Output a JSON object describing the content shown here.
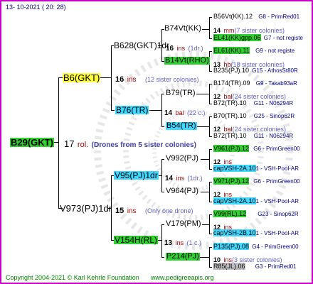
{
  "header": {
    "date": "13- 10-2021 ( 20: 28)"
  },
  "footer": {
    "copyright": "Copyright 2004-2021 © Karl Kehrle Foundation",
    "site": "www.pedigreeapis.org"
  },
  "root": {
    "id": "B29(GKT)",
    "count": "17",
    "ins": "rol.",
    "note": "(Drones from 5 sister colonies)"
  },
  "g1": {
    "mother": {
      "id": "B6(GKT)",
      "count": "16",
      "ins": "ins",
      "note": "(12 sister colonies)"
    },
    "father": {
      "id": "V973(PJ)1dr",
      "count": "15",
      "ins": "ins",
      "note": "(Only one drone)"
    }
  },
  "g2": {
    "b628": {
      "id": "B628(GKT)1dr",
      "count": "16",
      "ins": "ins",
      "note": "(1dr.)"
    },
    "b76": {
      "id": "B76(TR)",
      "count": "14",
      "ins": "bal",
      "note": "(22 c.)"
    },
    "v95": {
      "id": "V95(PJ)1dr",
      "count": "14",
      "ins": "ins",
      "note": "(1dr.)"
    },
    "v154": {
      "id": "V154H(RL)",
      "count": "13",
      "ins": "ins",
      "note": "(1 c.)"
    }
  },
  "g3": {
    "b74vt": {
      "id": "B74Vt(KK)"
    },
    "b14vt": {
      "id": "B14Vt(RHO)"
    },
    "b79": {
      "id": "B79(TR)"
    },
    "b54": {
      "id": "B54(TR)"
    },
    "v992": {
      "id": "V992(PJ)"
    },
    "v964": {
      "id": "V964(PJ)"
    },
    "v179": {
      "id": "V179(PM)"
    },
    "p214": {
      "id": "P214(PJ)"
    }
  },
  "g4": [
    {
      "id": "B56Vt(KK).12",
      "lin": "G8 - PrimRed01"
    },
    {
      "count": "14",
      "ins": "mm",
      "note": "(7 sister colonies)"
    },
    {
      "id": "EL41(KK)gpp.06",
      "lin": "G7 - not registe"
    },
    {
      "id": "EL61(KK).11",
      "lin": "G9 - not registe"
    },
    {
      "count": "13",
      "ins": "hb",
      "note": "(18 sister colonies)"
    },
    {
      "id": "B235(PJ).10",
      "lin": "G15 - AthosSt80R"
    },
    {
      "id": "B174(TR).09",
      "lin": "G9 - Takab93aR"
    },
    {
      "count": "12",
      "ins": "bal",
      "note": "(24 sister colonies)"
    },
    {
      "id": "B72(TR).10",
      "lin": "G11 - N06294R"
    },
    {
      "id": "B70(TR).10",
      "lin": "G25 - Sinop62R"
    },
    {
      "count": "12",
      "ins": "bal",
      "note": "(24 sister colonies)"
    },
    {
      "id": "B72(TR).10",
      "lin": "G11 - N06294R"
    },
    {
      "id": "V961(PJ).12",
      "lin": "G6 - PrimGreen00"
    },
    {
      "count": "12",
      "ins": "ins",
      "note": ""
    },
    {
      "id": "capVSH-2A.10",
      "lin": "1 - VSH-Pool-AR"
    },
    {
      "id": "V971(PJ).12",
      "lin": "G6 - PrimGreen00"
    },
    {
      "count": "12",
      "ins": "ins",
      "note": ""
    },
    {
      "id": "capVSH-2A.10",
      "lin": "1 - VSH-Pool-AR"
    },
    {
      "id": "V99(RL).12",
      "lin": "G23 - Sinop62R"
    },
    {
      "count": "12",
      "ins": "ins",
      "note": ""
    },
    {
      "id": "capVSH-2B.10",
      "lin": "1 - VSH-Pool-AR"
    },
    {
      "id": "P135(PJ).08",
      "lin": "G4 - PrimGreen00"
    },
    {
      "count": "10",
      "ins": "ins",
      "note": "(3 sister colonies)"
    },
    {
      "id": "R85(JL).06",
      "lin": "G3 - PrimRed01"
    }
  ]
}
